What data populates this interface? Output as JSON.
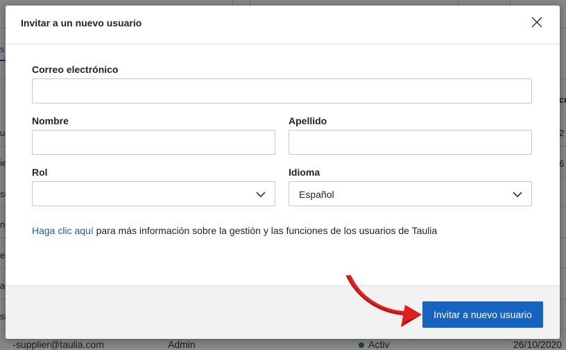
{
  "background": {
    "tab_fragment": "s",
    "left_fragments": [
      "up",
      "ie",
      "su",
      "ng",
      "ec",
      "ac",
      "su"
    ],
    "right_fragments": [
      "cr",
      "2",
      "6"
    ],
    "bottom_row": {
      "email": "-supplier@taulia.com",
      "role": "Admin",
      "status": "Activ",
      "date": "26/10/2020"
    }
  },
  "modal": {
    "title": "Invitar a un nuevo usuario",
    "close_icon": "close-icon",
    "email": {
      "label": "Correo electrónico",
      "value": ""
    },
    "first_name": {
      "label": "Nombre",
      "value": ""
    },
    "last_name": {
      "label": "Apellido",
      "value": ""
    },
    "role": {
      "label": "Rol",
      "selected": ""
    },
    "language": {
      "label": "Idioma",
      "selected": "Español"
    },
    "info": {
      "link_text": "Haga clic aquí",
      "text": " para más información sobre la gestión y las funciones de los usuarios de Taulia"
    },
    "submit_label": "Invitar a nuevo usuario"
  },
  "colors": {
    "primary": "#1565c0",
    "link": "#1a5bb5",
    "arrow": "#e02020",
    "status_active": "#2e8b57"
  }
}
